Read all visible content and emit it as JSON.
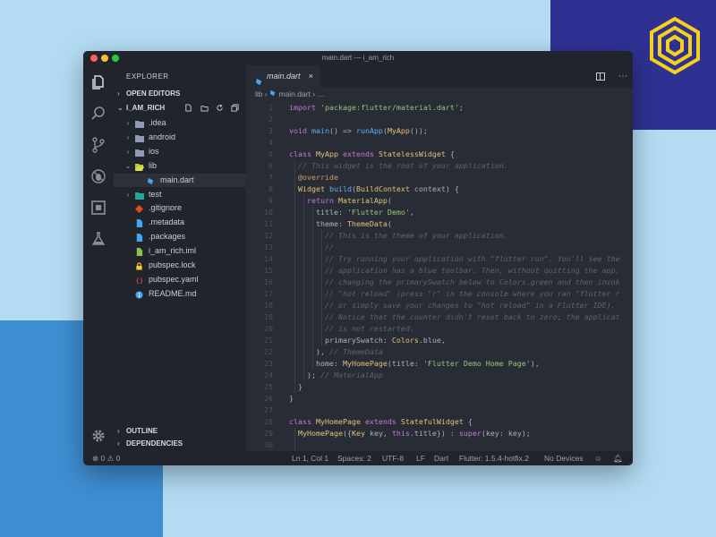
{
  "colors": {
    "accent": "#61afef",
    "brand_yellow": "#f7d117",
    "brand_navy": "#2e3192"
  },
  "window": {
    "title": "main.dart — i_am_rich"
  },
  "activity_bar": [
    "files-icon",
    "search-icon",
    "source-control-icon",
    "debug-icon",
    "extensions-icon",
    "test-flask-icon",
    "settings-icon"
  ],
  "sidebar": {
    "title": "EXPLORER",
    "open_editors": "OPEN EDITORS",
    "project": "I_AM_RICH",
    "tree": [
      {
        "label": ".idea",
        "icon": "folder-icon"
      },
      {
        "label": "android",
        "icon": "folder-icon"
      },
      {
        "label": "ios",
        "icon": "folder-icon"
      },
      {
        "label": "lib",
        "icon": "folder-open-icon"
      },
      {
        "label": "main.dart",
        "icon": "dart-file-icon"
      },
      {
        "label": "test",
        "icon": "folder-test-icon"
      },
      {
        "label": ".gitignore",
        "icon": "git-icon"
      },
      {
        "label": ".metadata",
        "icon": "file-icon"
      },
      {
        "label": ".packages",
        "icon": "file-icon"
      },
      {
        "label": "i_am_rich.iml",
        "icon": "iml-file-icon"
      },
      {
        "label": "pubspec.lock",
        "icon": "lock-icon"
      },
      {
        "label": "pubspec.yaml",
        "icon": "yaml-icon"
      },
      {
        "label": "README.md",
        "icon": "info-icon"
      }
    ],
    "outline": "OUTLINE",
    "dependencies": "DEPENDENCIES"
  },
  "editor": {
    "tab_label": "main.dart",
    "tab_close": "×",
    "breadcrumb": {
      "folder": "lib",
      "separator": "›",
      "file": "main.dart",
      "ellipsis": "…"
    },
    "line_numbers": [
      "1",
      "2",
      "3",
      "4",
      "5",
      "6",
      "7",
      "8",
      "9",
      "10",
      "11",
      "12",
      "13",
      "14",
      "15",
      "16",
      "17",
      "18",
      "19",
      "20",
      "21",
      "22",
      "23",
      "24",
      "25",
      "26",
      "27",
      "28",
      "29",
      "30"
    ],
    "lines": [
      "import 'package:flutter/material.dart';",
      "",
      "void main() => runApp(MyApp());",
      "",
      "class MyApp extends StatelessWidget {",
      "  // This widget is the root of your application.",
      "  @override",
      "  Widget build(BuildContext context) {",
      "    return MaterialApp(",
      "      title: 'Flutter Demo',",
      "      theme: ThemeData(",
      "        // This is the theme of your application.",
      "        //",
      "        // Try running your application with \"flutter run\". You'll see the",
      "        // application has a blue toolbar. Then, without quitting the app,",
      "        // changing the primarySwatch below to Colors.green and then invok",
      "        // \"hot reload\" (press \"r\" in the console where you ran \"flutter r",
      "        // or simply save your changes to \"hot reload\" in a Flutter IDE).",
      "        // Notice that the counter didn't reset back to zero; the applicat",
      "        // is not restarted.",
      "        primarySwatch: Colors.blue,",
      "      ), // ThemeData",
      "      home: MyHomePage(title: 'Flutter Demo Home Page'),",
      "    ); // MaterialApp",
      "  }",
      "}",
      "",
      "class MyHomePage extends StatefulWidget {",
      "  MyHomePage({Key key, this.title}) : super(key: key);",
      ""
    ]
  },
  "statusbar": {
    "errors": "0",
    "warnings": "0",
    "position": "Ln 1, Col 1",
    "spaces": "Spaces: 2",
    "encoding": "UTF-8",
    "eol": "LF",
    "language": "Dart",
    "flutter": "Flutter: 1.5.4-hotfix.2",
    "devices": "No Devices"
  }
}
